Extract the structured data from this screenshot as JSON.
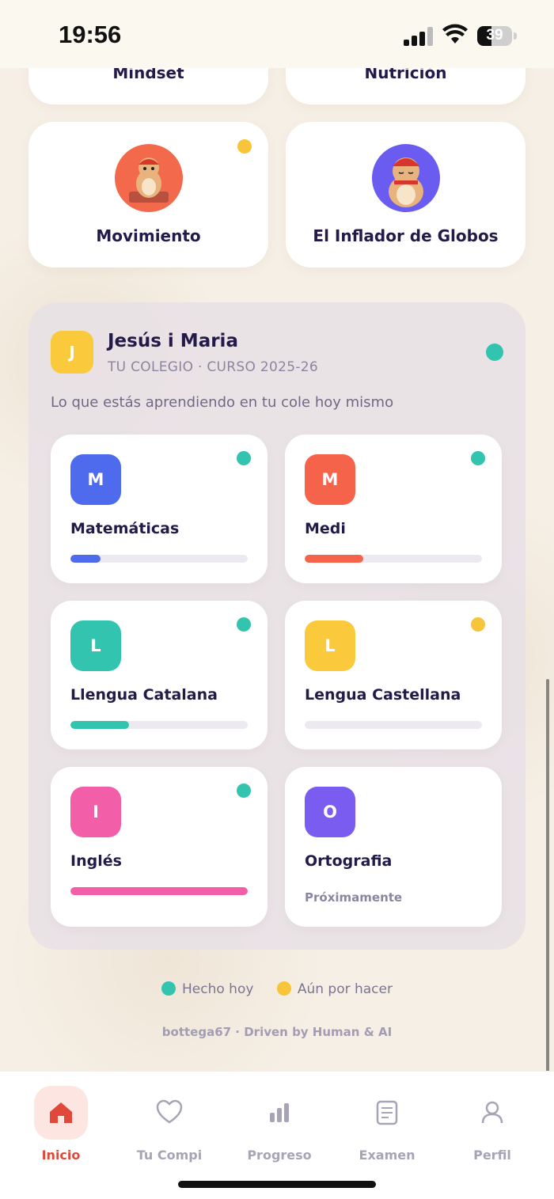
{
  "status_bar": {
    "time": "19:56",
    "battery": "39"
  },
  "top_cards": [
    {
      "title": "Mindset"
    },
    {
      "title": "Nutrición"
    },
    {
      "title": "Movimiento",
      "status": "pending"
    },
    {
      "title": "El Inflador de Globos"
    }
  ],
  "school": {
    "initial": "J",
    "name": "Jesús i Maria",
    "subtitle": "TU COLEGIO · CURSO 2025-26",
    "description": "Lo que estás aprendiendo en tu cole hoy mismo",
    "status": "done"
  },
  "subjects": [
    {
      "letter": "M",
      "name": "Matemáticas",
      "color": "#4f6bed",
      "progress": 0.17,
      "status": "done"
    },
    {
      "letter": "M",
      "name": "Medi",
      "color": "#f5634a",
      "progress": 0.33,
      "status": "done"
    },
    {
      "letter": "L",
      "name": "Llengua Catalana",
      "color": "#33c4b0",
      "progress": 0.33,
      "status": "done"
    },
    {
      "letter": "L",
      "name": "Lengua Castellana",
      "color": "#fac93c",
      "progress": 0,
      "status": "pending"
    },
    {
      "letter": "I",
      "name": "Inglés",
      "color": "#f25ea8",
      "progress": 1.0,
      "status": "done"
    },
    {
      "letter": "O",
      "name": "Ortografia",
      "color": "#7b5cf0",
      "soon": "Próximamente"
    }
  ],
  "legend": {
    "done": "Hecho hoy",
    "pending": "Aún por hacer"
  },
  "footer": "bottega67 · Driven by Human & AI",
  "colors": {
    "done": "#33c4b0",
    "pending": "#f7c43a",
    "active_tab": "#e0483a"
  },
  "tabs": [
    {
      "label": "Inicio",
      "icon": "home-icon",
      "active": true
    },
    {
      "label": "Tu Compi",
      "icon": "heart-icon"
    },
    {
      "label": "Progreso",
      "icon": "bar-chart-icon"
    },
    {
      "label": "Examen",
      "icon": "document-icon"
    },
    {
      "label": "Perfil",
      "icon": "user-icon"
    }
  ]
}
